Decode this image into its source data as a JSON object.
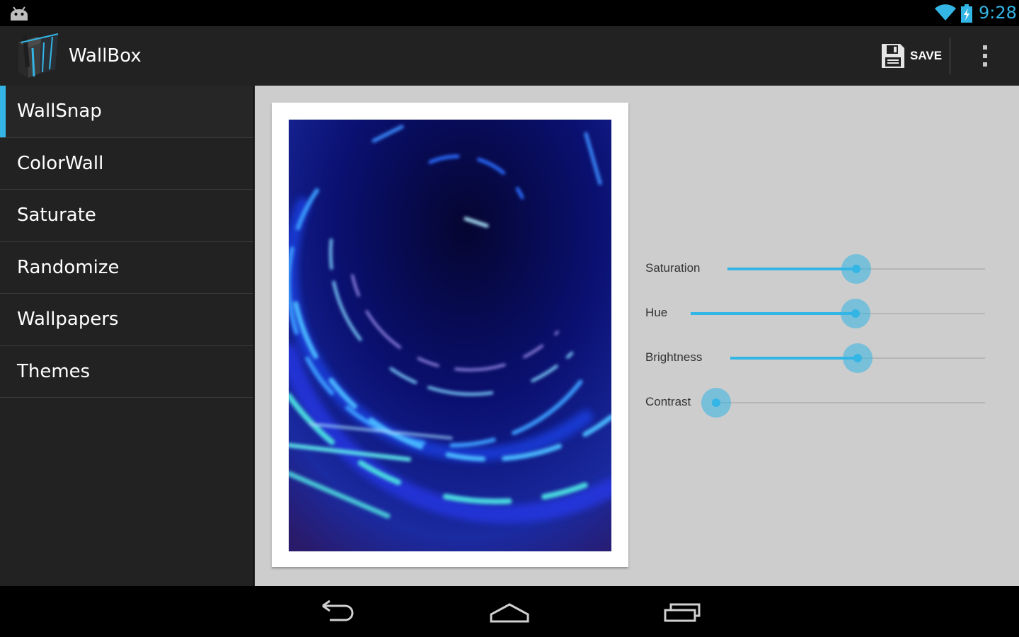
{
  "status_bar": {
    "time": "9:28",
    "accent_color": "#33b5e5",
    "icons": [
      "android-icon",
      "wifi-icon",
      "battery-charging-icon"
    ]
  },
  "action_bar": {
    "app_title": "WallBox",
    "save_label": "SAVE",
    "icons": [
      "wallbox-logo-icon",
      "save-disk-icon",
      "overflow-menu-icon"
    ]
  },
  "sidebar": {
    "active_index": 0,
    "items": [
      {
        "label": "WallSnap"
      },
      {
        "label": "ColorWall"
      },
      {
        "label": "Saturate"
      },
      {
        "label": "Randomize"
      },
      {
        "label": "Wallpapers"
      },
      {
        "label": "Themes"
      }
    ]
  },
  "sliders": [
    {
      "label": "Saturation",
      "value": 0.5
    },
    {
      "label": "Hue",
      "value": 0.56
    },
    {
      "label": "Brightness",
      "value": 0.5
    },
    {
      "label": "Contrast",
      "value": 0.0
    }
  ],
  "nav_bar": {
    "icons": [
      "back-icon",
      "home-icon",
      "recents-icon"
    ]
  },
  "colors": {
    "accent": "#33b5e5",
    "action_bar": "#222222",
    "content_bg": "#cdcdcd"
  }
}
